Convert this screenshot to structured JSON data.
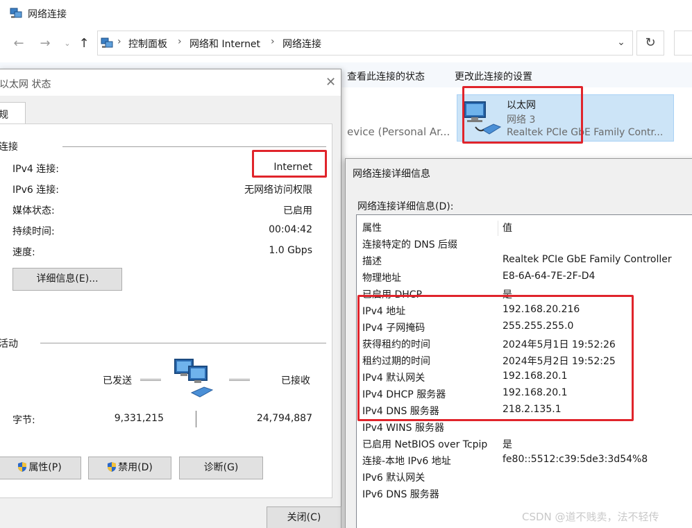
{
  "explorer": {
    "title": "网络连接",
    "breadcrumb": [
      "控制面板",
      "网络和 Internet",
      "网络连接"
    ],
    "commands": [
      "查看此连接的状态",
      "更改此连接的设置"
    ],
    "other_item_text": "evice (Personal Ar...",
    "ethernet_item": {
      "name": "以太网",
      "network": "网络 3",
      "adapter": "Realtek PCIe GbE Family Contr..."
    }
  },
  "status_dialog": {
    "title": "以太网 状态",
    "tab_label": "规",
    "connection_group": "连接",
    "rows": [
      {
        "label": "IPv4 连接:",
        "value": "Internet"
      },
      {
        "label": "IPv6 连接:",
        "value": "无网络访问权限"
      },
      {
        "label": "媒体状态:",
        "value": "已启用"
      },
      {
        "label": "持续时间:",
        "value": "00:04:42"
      },
      {
        "label": "速度:",
        "value": "1.0 Gbps"
      }
    ],
    "details_button": "详细信息(E)...",
    "activity_group": "活动",
    "sent_label": "已发送",
    "received_label": "已接收",
    "bytes_label": "字节:",
    "bytes_sent": "9,331,215",
    "bytes_received": "24,794,887",
    "buttons": {
      "properties": "属性(P)",
      "disable": "禁用(D)",
      "diagnose": "诊断(G)",
      "close": "关闭(C)"
    }
  },
  "details_dialog": {
    "title": "网络连接详细信息",
    "list_label": "网络连接详细信息(D):",
    "header": {
      "key": "属性",
      "value": "值"
    },
    "rows": [
      {
        "key": "连接特定的 DNS 后缀",
        "value": ""
      },
      {
        "key": "描述",
        "value": "Realtek PCIe GbE Family Controller"
      },
      {
        "key": "物理地址",
        "value": "E8-6A-64-7E-2F-D4"
      },
      {
        "key": "已启用 DHCP",
        "value": "是"
      },
      {
        "key": "IPv4 地址",
        "value": "192.168.20.216"
      },
      {
        "key": "IPv4 子网掩码",
        "value": "255.255.255.0"
      },
      {
        "key": "获得租约的时间",
        "value": "2024年5月1日 19:52:26"
      },
      {
        "key": "租约过期的时间",
        "value": "2024年5月2日 19:52:25"
      },
      {
        "key": "IPv4 默认网关",
        "value": "192.168.20.1"
      },
      {
        "key": "IPv4 DHCP 服务器",
        "value": "192.168.20.1"
      },
      {
        "key": "IPv4 DNS 服务器",
        "value": "218.2.135.1"
      },
      {
        "key": "IPv4 WINS 服务器",
        "value": ""
      },
      {
        "key": "已启用 NetBIOS over Tcpip",
        "value": "是"
      },
      {
        "key": "连接-本地 IPv6 地址",
        "value": "fe80::5512:c39:5de3:3d54%8"
      },
      {
        "key": "IPv6 默认网关",
        "value": ""
      },
      {
        "key": "IPv6 DNS 服务器",
        "value": ""
      }
    ]
  },
  "watermark": "CSDN @道不贱卖，法不轻传",
  "colors": {
    "highlight_box": "#e0242b",
    "selection": "#cce4f7",
    "command_bar": "#f5f8fc"
  }
}
